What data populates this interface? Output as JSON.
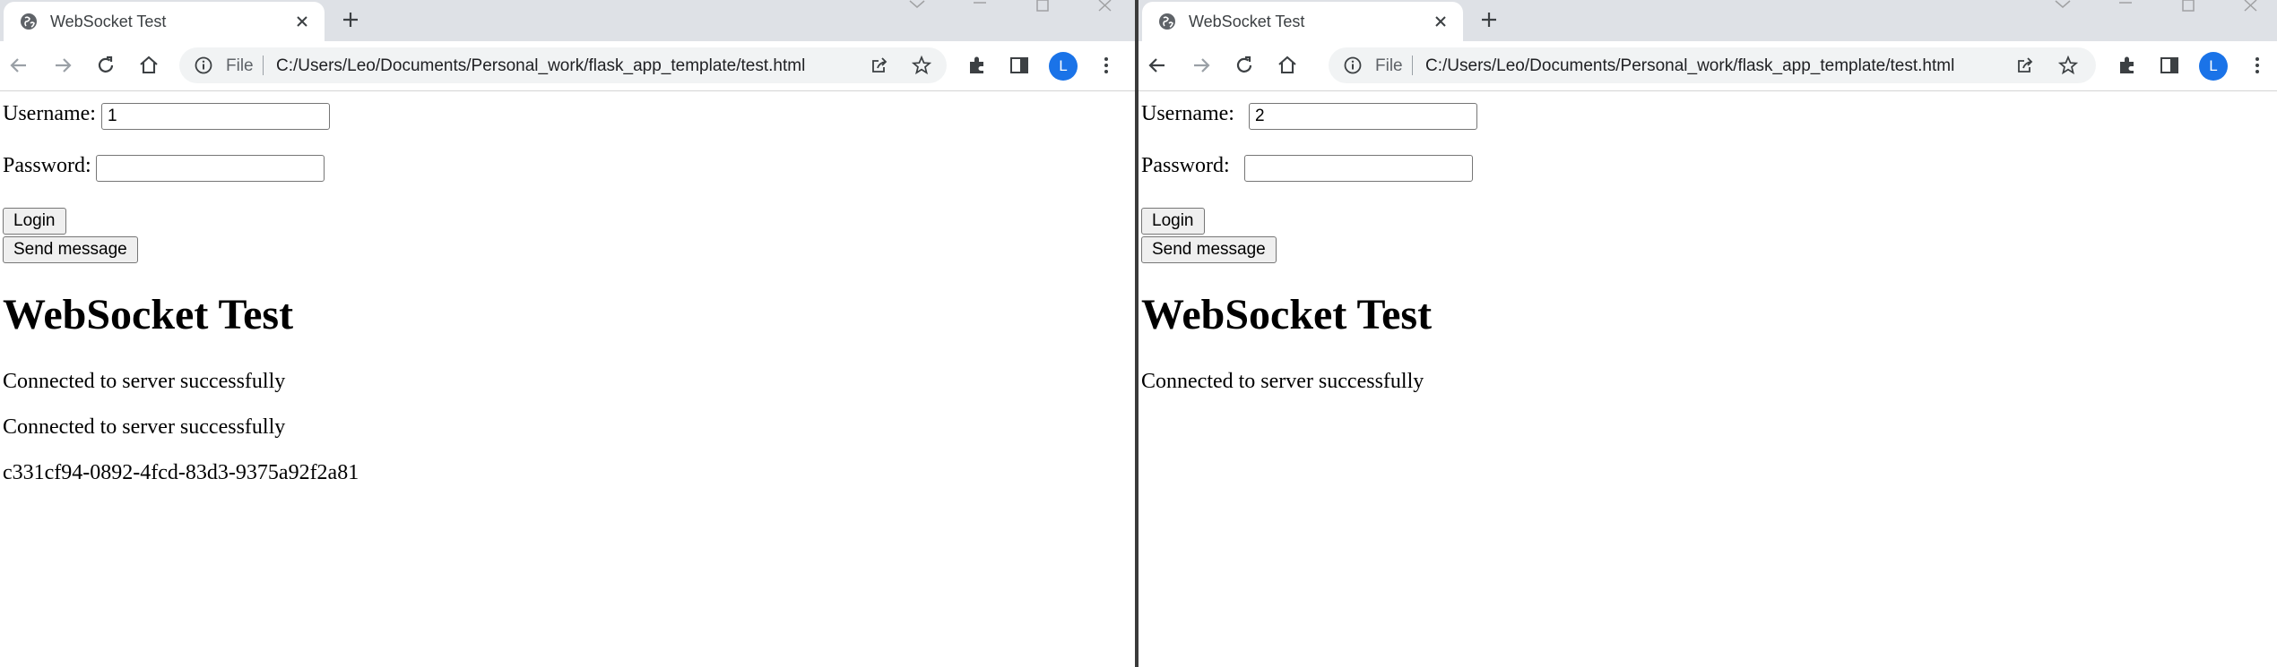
{
  "windows": [
    {
      "tab_title": "WebSocket Test",
      "omnibox": {
        "scheme": "File",
        "url": "C:/Users/Leo/Documents/Personal_work/flask_app_template/test.html"
      },
      "profile_initial": "L",
      "form": {
        "username_label": "Username:",
        "username_value": "1",
        "password_label": "Password:",
        "password_value": "",
        "login_label": "Login",
        "send_label": "Send message"
      },
      "heading": "WebSocket Test",
      "messages": [
        "Connected to server successfully",
        "Connected to server successfully",
        "c331cf94-0892-4fcd-83d3-9375a92f2a81"
      ]
    },
    {
      "tab_title": "WebSocket Test",
      "omnibox": {
        "scheme": "File",
        "url": "C:/Users/Leo/Documents/Personal_work/flask_app_template/test.html"
      },
      "profile_initial": "L",
      "form": {
        "username_label": "Username:",
        "username_value": "2",
        "password_label": "Password:",
        "password_value": "",
        "login_label": "Login",
        "send_label": "Send message"
      },
      "heading": "WebSocket Test",
      "messages": [
        "Connected to server successfully"
      ]
    }
  ],
  "icons": [
    "globe-icon",
    "close-icon",
    "plus-icon",
    "back-icon",
    "forward-icon",
    "reload-icon",
    "home-icon",
    "info-icon",
    "share-icon",
    "star-icon",
    "extensions-icon",
    "side-panel-icon",
    "menu-icon"
  ],
  "colors": {
    "tabstrip": "#dee1e6",
    "omnibox": "#f1f3f4",
    "avatar": "#1a73e8",
    "button": "#efefef"
  }
}
